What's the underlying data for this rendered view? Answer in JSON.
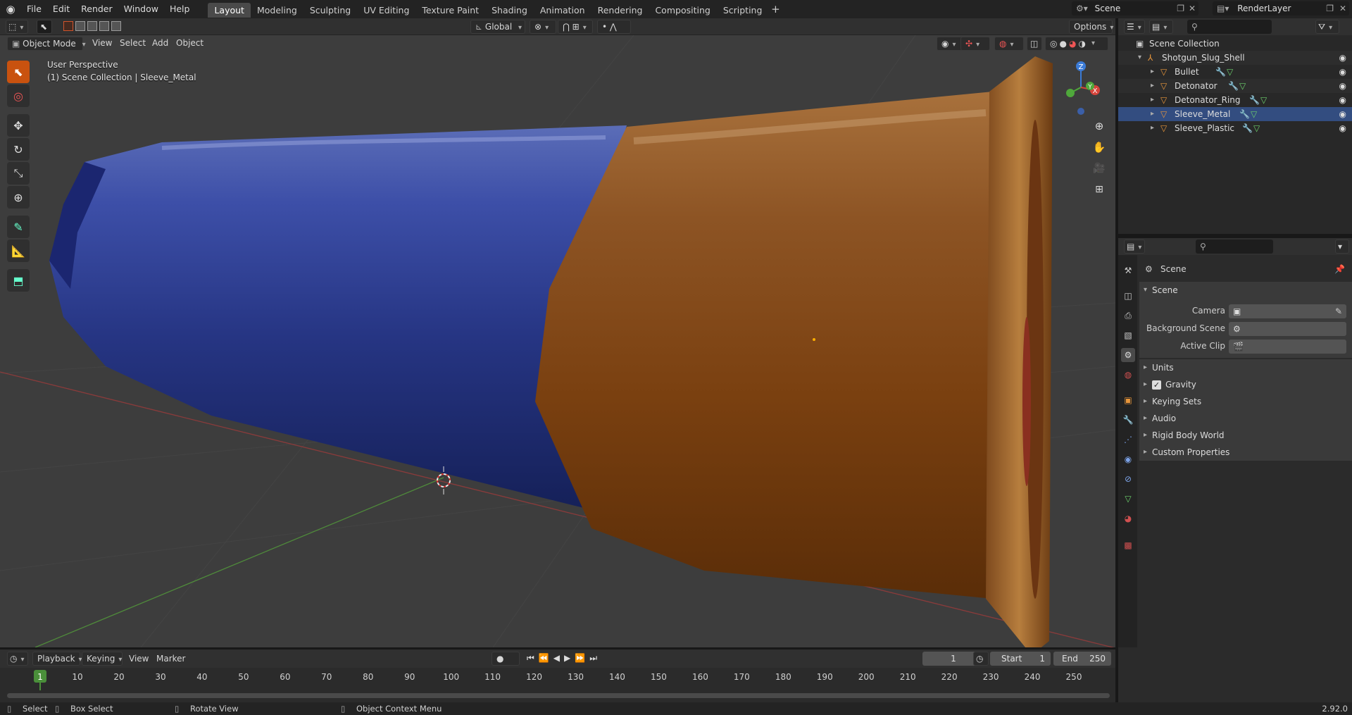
{
  "topbar": {
    "menus": [
      "File",
      "Edit",
      "Render",
      "Window",
      "Help"
    ],
    "workspaces": [
      "Layout",
      "Modeling",
      "Sculpting",
      "UV Editing",
      "Texture Paint",
      "Shading",
      "Animation",
      "Rendering",
      "Compositing",
      "Scripting"
    ],
    "active_workspace": "Layout",
    "scene_name": "Scene",
    "render_layer": "RenderLayer"
  },
  "viewport_header": {
    "transform_orientation": "Global",
    "options_label": "Options",
    "mode": "Object Mode",
    "menus": [
      "View",
      "Select",
      "Add",
      "Object"
    ]
  },
  "viewport": {
    "perspective_label": "User Perspective",
    "collection_label": "(1) Scene Collection | Sleeve_Metal",
    "gizmo_axes": {
      "z": "Z",
      "y": "Y",
      "x": "X"
    }
  },
  "outliner": {
    "root": "Scene Collection",
    "parent": "Shotgun_Slug_Shell",
    "children": [
      "Bullet",
      "Detonator",
      "Detonator_Ring",
      "Sleeve_Metal",
      "Sleeve_Plastic"
    ]
  },
  "properties": {
    "context_title": "Scene",
    "panel_title": "Scene",
    "fields": {
      "camera": "Camera",
      "background_scene": "Background Scene",
      "active_clip": "Active Clip"
    },
    "sections": [
      "Units",
      "Gravity",
      "Keying Sets",
      "Audio",
      "Rigid Body World",
      "Custom Properties"
    ],
    "gravity_checked": true
  },
  "timeline": {
    "menus": [
      "Playback",
      "Keying",
      "View",
      "Marker"
    ],
    "current_frame": "1",
    "start_label": "Start",
    "start_value": "1",
    "end_label": "End",
    "end_value": "250",
    "ticks": [
      "1",
      "10",
      "20",
      "30",
      "40",
      "50",
      "60",
      "70",
      "80",
      "90",
      "100",
      "110",
      "120",
      "130",
      "140",
      "150",
      "160",
      "170",
      "180",
      "190",
      "200",
      "210",
      "220",
      "230",
      "240",
      "250"
    ]
  },
  "statusbar": {
    "select": "Select",
    "box_select": "Box Select",
    "rotate_view": "Rotate View",
    "context_menu": "Object Context Menu",
    "version": "2.92.0"
  },
  "colors": {
    "accent": "#c9520f",
    "blue_plastic": "#27337a",
    "brass": "#8a4a14"
  }
}
